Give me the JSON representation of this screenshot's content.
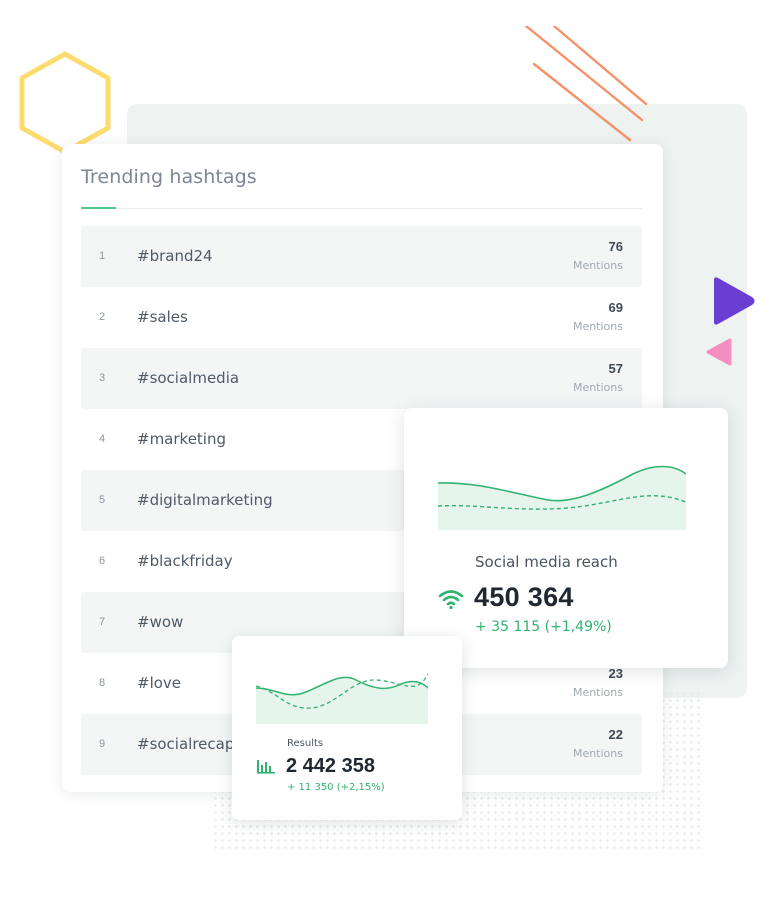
{
  "trending": {
    "title": "Trending hashtags",
    "rows": [
      {
        "rank": "1",
        "tag": "#brand24",
        "count": "76",
        "unit": "Mentions"
      },
      {
        "rank": "2",
        "tag": "#sales",
        "count": "69",
        "unit": "Mentions"
      },
      {
        "rank": "3",
        "tag": "#socialmedia",
        "count": "57",
        "unit": "Mentions"
      },
      {
        "rank": "4",
        "tag": "#marketing",
        "count": "",
        "unit": ""
      },
      {
        "rank": "5",
        "tag": "#digitalmarketing",
        "count": "",
        "unit": ""
      },
      {
        "rank": "6",
        "tag": "#blackfriday",
        "count": "",
        "unit": ""
      },
      {
        "rank": "7",
        "tag": "#wow",
        "count": "",
        "unit": ""
      },
      {
        "rank": "8",
        "tag": "#love",
        "count": "23",
        "unit": "Mentions"
      },
      {
        "rank": "9",
        "tag": "#socialrecap",
        "count": "22",
        "unit": "Mentions"
      }
    ]
  },
  "reach": {
    "label": "Social media reach",
    "value": "450 364",
    "change": "+ 35 115 (+1,49%)",
    "icon": "wifi-signal-icon"
  },
  "results": {
    "label": "Results",
    "value": "2 442 358",
    "change": "+ 11 350 (+2,15%)",
    "icon": "bar-chart-icon"
  },
  "colors": {
    "accent_green": "#2fb36f",
    "chart_fill": "#e6f5ec",
    "hexagon": "#fcdc6e",
    "stripes": "#f6916a",
    "purple": "#6a3ed1",
    "pink": "#f48fc4"
  }
}
